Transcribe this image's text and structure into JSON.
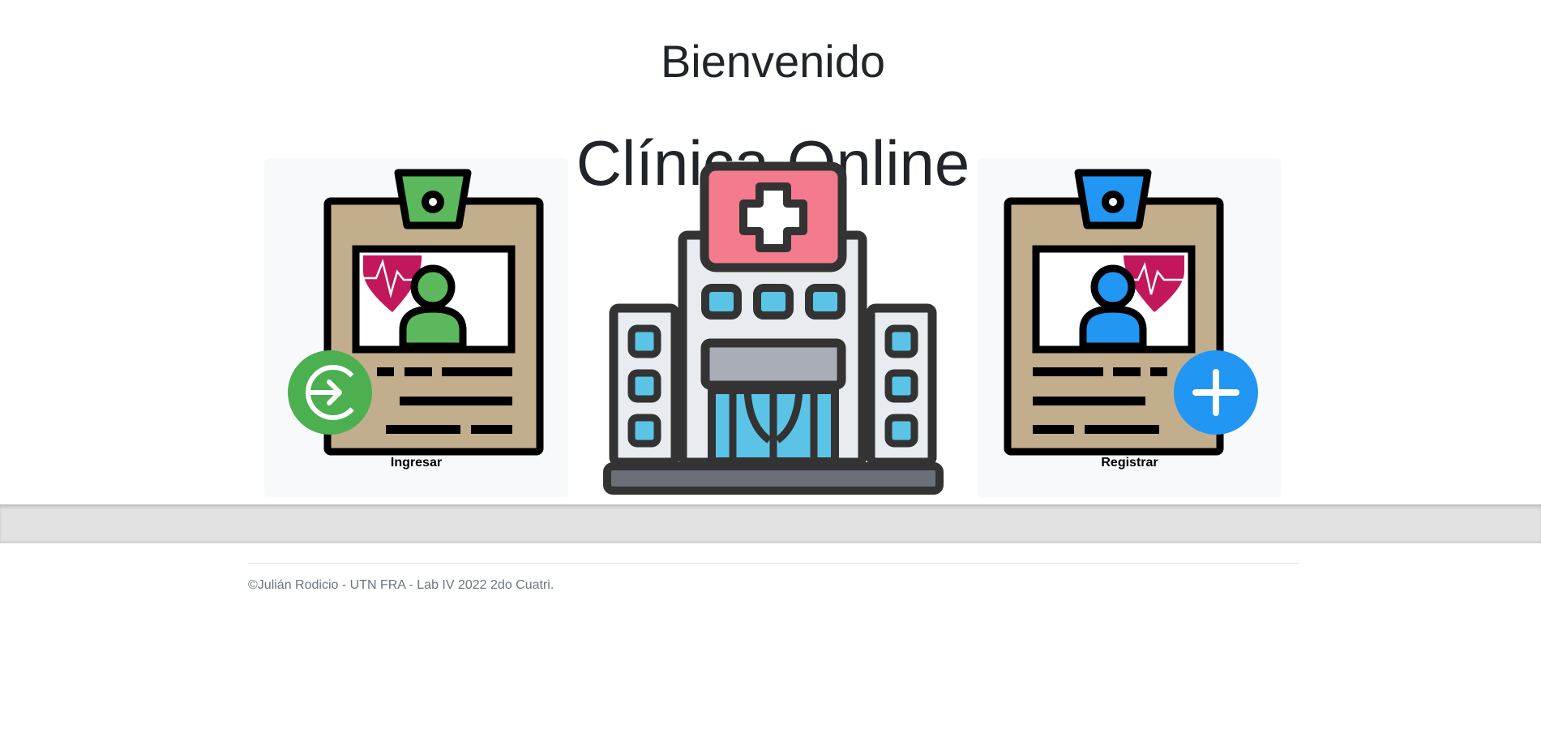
{
  "header": {
    "greeting": "Bienvenido",
    "title": "Clínica Online"
  },
  "cards": {
    "login": {
      "label": "Ingresar",
      "icon": "login-arrow-icon",
      "accent": "#5cb85c",
      "badge_color": "#4caf50"
    },
    "register": {
      "label": "Registrar",
      "icon": "plus-icon",
      "accent": "#2196f3",
      "badge_color": "#2196f3"
    }
  },
  "hospital": {
    "icon": "hospital-building-icon"
  },
  "footer": {
    "text": "©Julián Rodicio - UTN FRA - Lab IV 2022 2do Cuatri."
  },
  "colors": {
    "text": "#212529",
    "card_bg": "#f8f9fa",
    "badge_tan": "#c2ae8c",
    "heart": "#c2185b",
    "outline": "#000000",
    "hospital_red": "#f47a8d",
    "hospital_glass": "#5bc4e6",
    "hospital_wall": "#e8ebef",
    "footer_text": "#6c757d"
  }
}
